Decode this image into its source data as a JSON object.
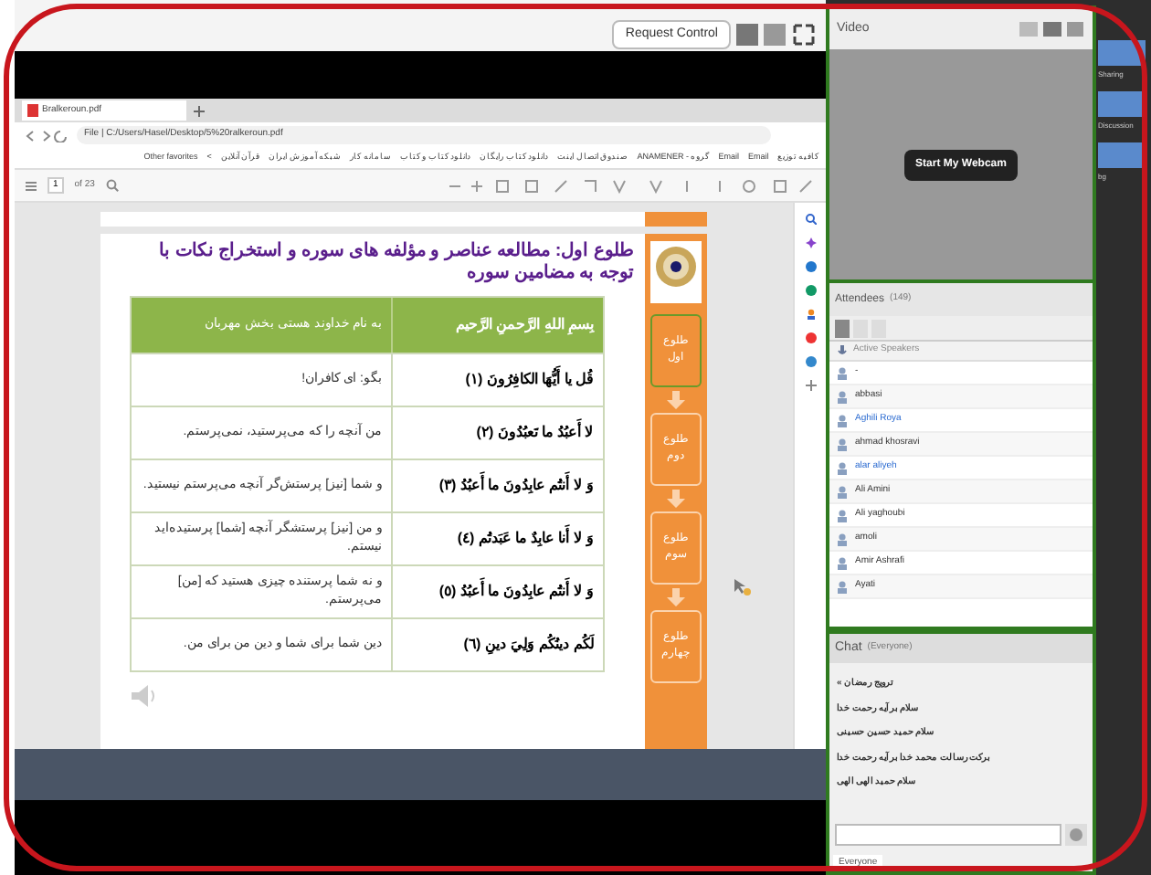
{
  "meeting_bar": {
    "request_control": "Request Control"
  },
  "browser": {
    "tab": "Bralkeroun.pdf",
    "address": "File | C:/Users/Hasel/Desktop/5%20ralkeroun.pdf",
    "bookmarks": [
      "کافیه توزیع",
      "Email",
      "Email",
      "گروه - ANAMENER",
      "صندوق اتصال اینت",
      "دانلود کتاب رایگان",
      "دانلود کتاب و کتاب",
      "سامانه کار",
      "شبکه آموزش ایران",
      "قرآن آنلاین",
      ">",
      "Other favorites"
    ],
    "page_field": "1",
    "page_count": "of 23"
  },
  "document": {
    "title": "طلوع اول: مطالعه عناصر و مؤلفه های سوره و استخراج نکات با توجه به مضامین سوره",
    "header": [
      "بِسمِ اللهِ الرَّحمنِ الرَّحيم",
      "به نام خداوند هستی بخش مهربان"
    ],
    "rows": [
      [
        "قُل يا أَيُّهَا الكافِرُونَ (١)",
        "بگو: ای کافران!"
      ],
      [
        "لا أَعبُدُ ما تَعبُدُونَ (٢)",
        "من آنچه را که می‌پرستید، نمی‌پرستم."
      ],
      [
        "وَ لا أَنتُم عابِدُونَ ما أَعبُدُ (٣)",
        "و شما [نیز] پرستش‌گر آنچه می‌پرستم نیستید."
      ],
      [
        "وَ لا أَنا عابِدٌ ما عَبَدتُم (٤)",
        "و من [نیز] پرستشگر آنچه [شما] پرستیده‌اید نیستم."
      ],
      [
        "وَ لا أَنتُم عابِدُونَ ما أَعبُدُ (٥)",
        "و نه شما پرستنده چیزی هستید که [من] می‌پرستم."
      ],
      [
        "لَكُم دينُكُم وَلِيَ دينِ (٦)",
        "دین شما برای شما و دین من برای من."
      ]
    ],
    "steps": [
      {
        "label": "طلوع اول",
        "selected": true
      },
      {
        "label": "طلوع دوم",
        "selected": false
      },
      {
        "label": "طلوع سوم",
        "selected": false
      },
      {
        "label": "طلوع چهارم",
        "selected": false
      }
    ]
  },
  "video": {
    "title": "Video",
    "button": "Start My Webcam"
  },
  "attendees": {
    "title": "Attendees",
    "count": "(149)",
    "active_speakers": "Active Speakers",
    "people": [
      {
        "name": "-",
        "highlighted": false
      },
      {
        "name": "abbasi",
        "highlighted": false
      },
      {
        "name": "Aghili Roya",
        "highlighted": true
      },
      {
        "name": "ahmad khosravi",
        "highlighted": false
      },
      {
        "name": "alar aliyeh",
        "highlighted": true
      },
      {
        "name": "Ali Amini",
        "highlighted": false
      },
      {
        "name": "Ali yaghoubi",
        "highlighted": false
      },
      {
        "name": "amoli",
        "highlighted": false
      },
      {
        "name": "Amir Ashrafi",
        "highlighted": false
      },
      {
        "name": "Ayati",
        "highlighted": false
      }
    ]
  },
  "chat": {
    "title": "Chat",
    "scope": "(Everyone)",
    "messages": [
      "« ترویج رمضان",
      "سلام بر آیه رحمت خدا",
      "سلام حمید حسین حسینی",
      "برکت رسالت محمد خدا بر آیه رحمت خدا",
      "سلام حمید الهی الهی"
    ],
    "tab": "Everyone"
  },
  "layouts": [
    "Sharing",
    "Discussion",
    "bg"
  ]
}
